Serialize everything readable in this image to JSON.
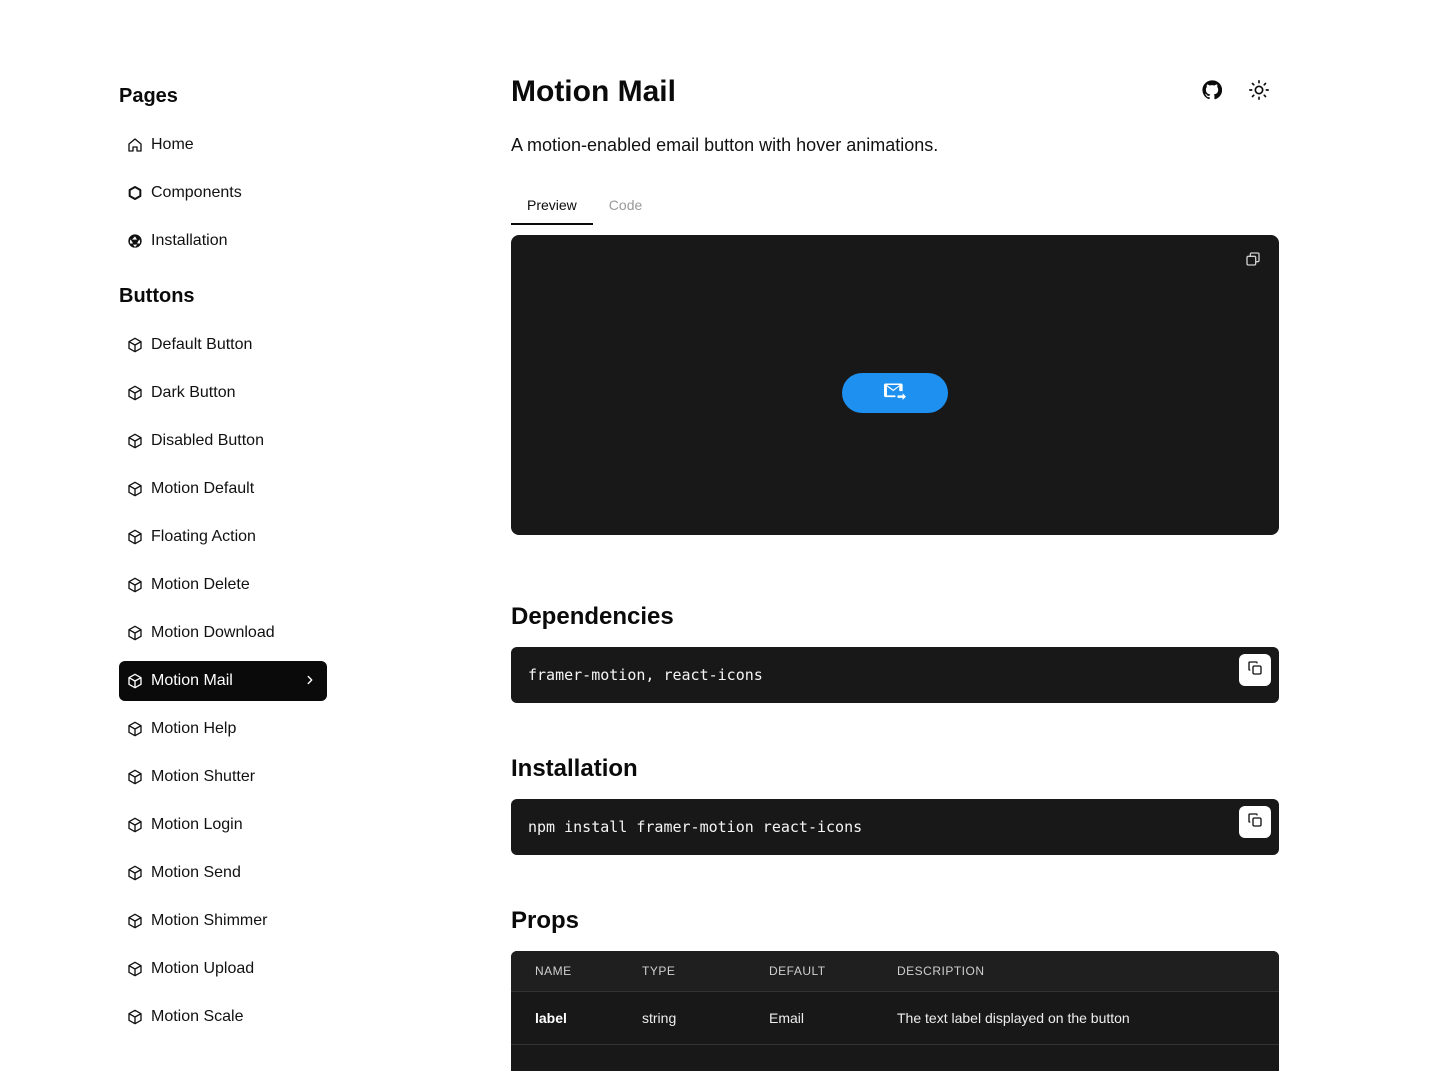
{
  "sidebar": {
    "pages_title": "Pages",
    "pages": [
      {
        "label": "Home",
        "icon": "home-icon"
      },
      {
        "label": "Components",
        "icon": "hexagon-icon"
      },
      {
        "label": "Installation",
        "icon": "aperture-icon"
      }
    ],
    "buttons_title": "Buttons",
    "buttons": [
      {
        "label": "Default Button"
      },
      {
        "label": "Dark Button"
      },
      {
        "label": "Disabled Button"
      },
      {
        "label": "Motion Default"
      },
      {
        "label": "Floating Action"
      },
      {
        "label": "Motion Delete"
      },
      {
        "label": "Motion Download"
      },
      {
        "label": "Motion Mail",
        "active": true
      },
      {
        "label": "Motion Help"
      },
      {
        "label": "Motion Shutter"
      },
      {
        "label": "Motion Login"
      },
      {
        "label": "Motion Send"
      },
      {
        "label": "Motion Shimmer"
      },
      {
        "label": "Motion Upload"
      },
      {
        "label": "Motion Scale"
      }
    ]
  },
  "main": {
    "title": "Motion Mail",
    "description": "A motion-enabled email button with hover animations.",
    "tabs": [
      {
        "label": "Preview",
        "active": true
      },
      {
        "label": "Code",
        "active": false
      }
    ],
    "dependencies_title": "Dependencies",
    "dependencies_code": "framer-motion, react-icons",
    "installation_title": "Installation",
    "installation_code": "npm install framer-motion react-icons",
    "props_title": "Props",
    "props_table": {
      "headers": [
        "NAME",
        "TYPE",
        "DEFAULT",
        "DESCRIPTION"
      ],
      "rows": [
        [
          "label",
          "string",
          "Email",
          "The text label displayed on the button"
        ]
      ]
    }
  },
  "colors": {
    "accent": "#1e90f0",
    "dark_surface": "#181818",
    "active_nav": "#0a0a0a"
  }
}
